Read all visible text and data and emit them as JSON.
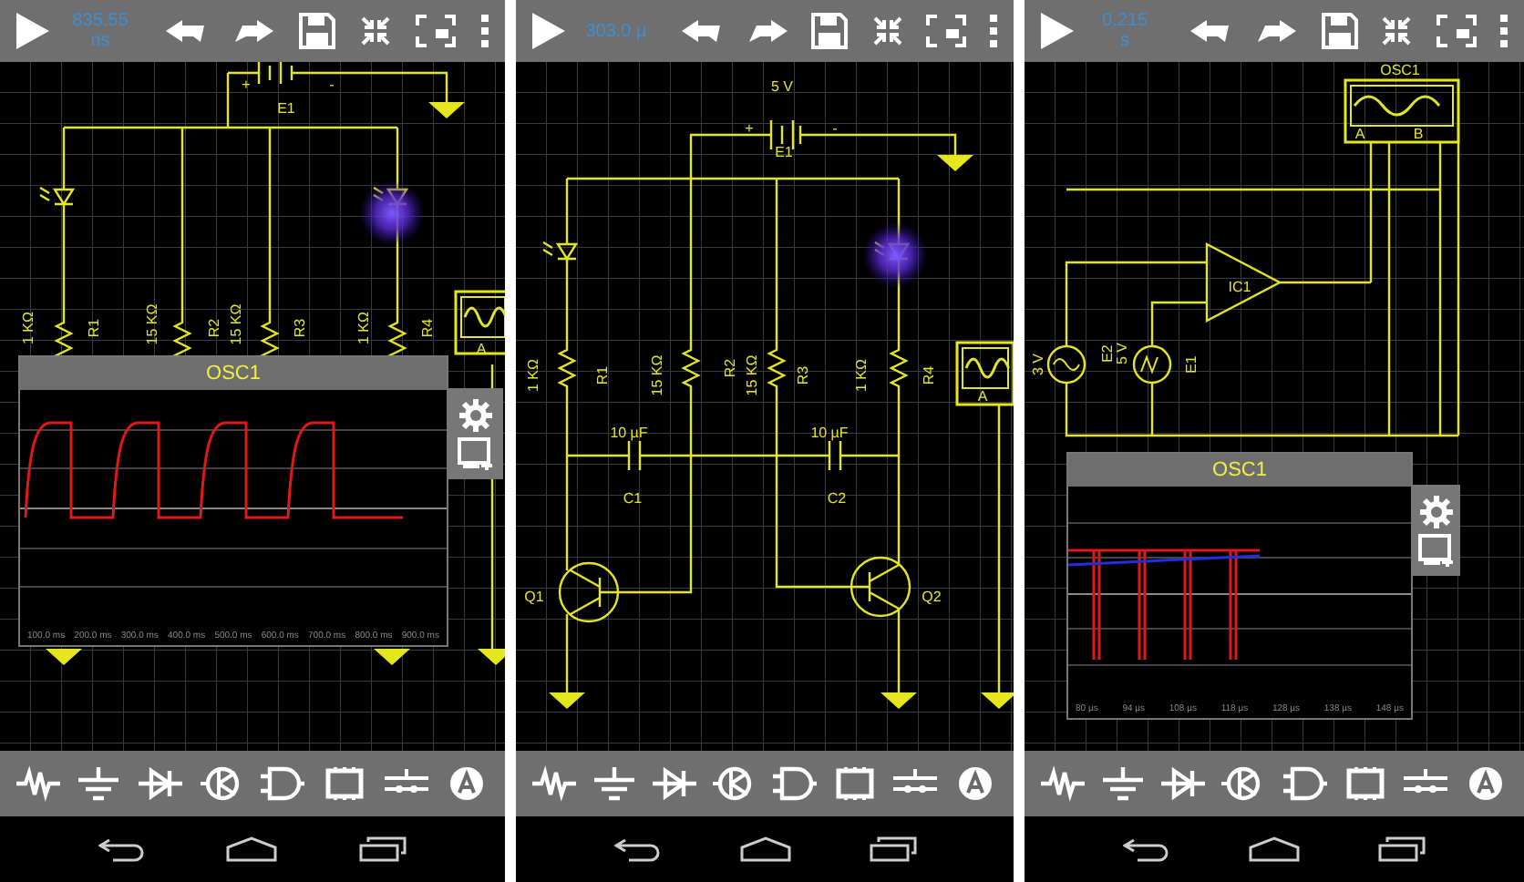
{
  "screens": [
    {
      "kind": "led-flasher",
      "clock": [
        "835.55",
        "ns"
      ],
      "labels": [
        "+",
        "-",
        "E1",
        "1 KΩ",
        "R1",
        "15 KΩ",
        "R2",
        "15 KΩ",
        "R3",
        "1 KΩ",
        "R4",
        "A"
      ],
      "scope": {
        "title": "OSC1",
        "ticks": [
          "100.0 ms",
          "200.0 ms",
          "300.0 ms",
          "400.0 ms",
          "500.0 ms",
          "600.0 ms",
          "700.0 ms",
          "800.0 ms",
          "900.0 ms"
        ]
      }
    },
    {
      "kind": "transistor-multivibrator",
      "clock": [
        "303.0 µ"
      ],
      "labels": [
        "5 V",
        "+",
        "-",
        "E1",
        "1 KΩ",
        "R1",
        "15 KΩ",
        "R2",
        "15 KΩ",
        "R3",
        "1 KΩ",
        "R4",
        "10 µF",
        "C1",
        "10 µF",
        "C2",
        "Q1",
        "Q2",
        "A"
      ]
    },
    {
      "kind": "op-amp",
      "clock": [
        "0.215",
        "s"
      ],
      "labels": [
        "OSC1",
        "A",
        "B",
        "IC1",
        "3 V",
        "E2",
        "5 V",
        "E1"
      ],
      "scope": {
        "title": "OSC1",
        "ticks": [
          "80 µs",
          "94 µs",
          "108 µs",
          "118 µs",
          "128 µs",
          "138 µs",
          "148 µs"
        ]
      }
    }
  ]
}
